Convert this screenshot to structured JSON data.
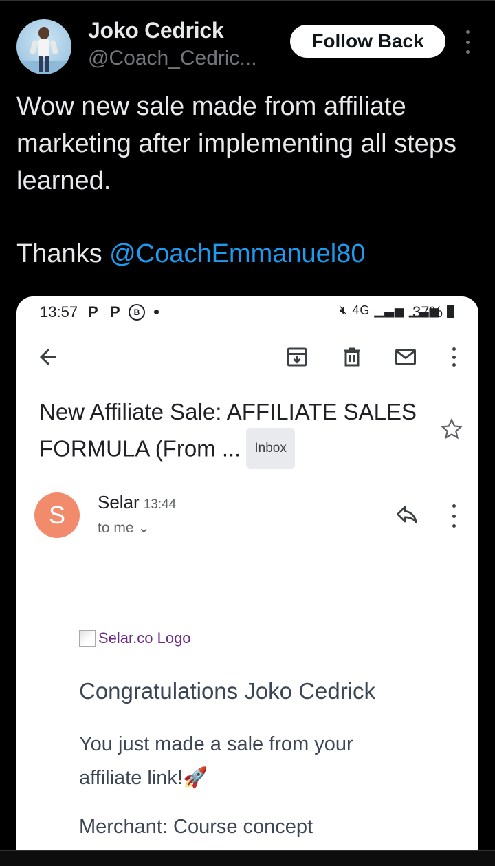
{
  "tweet": {
    "author_name": "Joko Cedrick",
    "author_handle": "@Coach_Cedric...",
    "follow_label": "Follow Back",
    "text": "Wow new sale made from affiliate marketing after implementing all steps  learned.",
    "thanks_prefix": "Thanks ",
    "mention": "@CoachEmmanuel80"
  },
  "phone_status": {
    "time": "13:57",
    "notif1": "P",
    "notif2": "P",
    "notif3": "B",
    "network": "4G",
    "battery": "37%"
  },
  "email": {
    "subject": "New Affiliate Sale: AFFILIATE SALES FORMULA (From ...",
    "label_chip": "Inbox",
    "sender_initial": "S",
    "sender_name": "Selar",
    "sent_time": "13:44",
    "recipient": "to me",
    "logo_alt": "Selar.co Logo",
    "greeting": "Congratulations Joko Cedrick",
    "body": "You just made a sale from your affiliate link!🚀",
    "merchant": "Merchant: Course concept"
  },
  "colors": {
    "background": "#000000",
    "mention": "#1d9bf0",
    "sender_avatar": "#f28b6b",
    "logo_alt_text": "#6b2a86"
  }
}
